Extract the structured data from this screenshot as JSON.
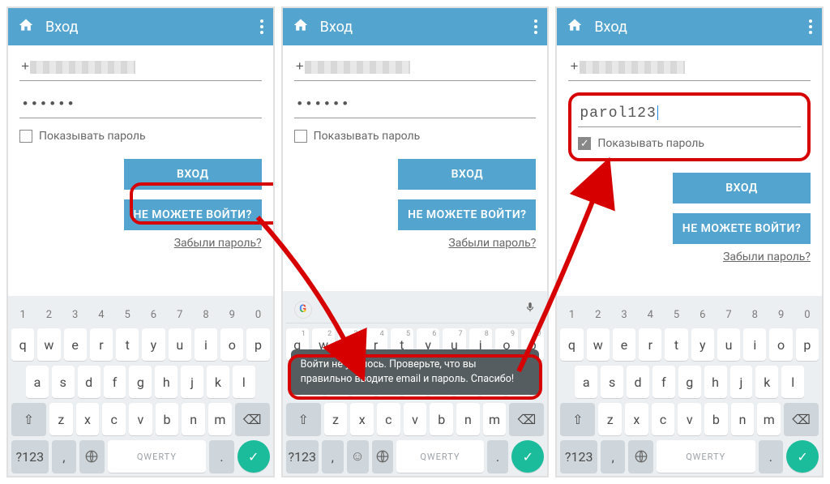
{
  "appBar": {
    "title": "Вход"
  },
  "fields": {
    "phonePrefix": "+",
    "passwordMasked": "••••••",
    "passwordVisible": "parol123"
  },
  "checkbox": {
    "label": "Показывать пароль"
  },
  "buttons": {
    "login": "ВХОД",
    "cantLogin": "НЕ МОЖЕТЕ ВОЙТИ?"
  },
  "forgot": "Забыли пароль?",
  "toast": "Войти не удалось. Проверьте, что вы правильно вводите email и пароль. Спасибо!",
  "keyboard": {
    "nums": [
      "1",
      "2",
      "3",
      "4",
      "5",
      "6",
      "7",
      "8",
      "9",
      "0"
    ],
    "row1": [
      "q",
      "w",
      "e",
      "r",
      "t",
      "y",
      "u",
      "i",
      "o",
      "p"
    ],
    "row2": [
      "a",
      "s",
      "d",
      "f",
      "g",
      "h",
      "j",
      "k",
      "l"
    ],
    "row3": [
      "z",
      "x",
      "c",
      "v",
      "b",
      "n",
      "m"
    ],
    "symKey": "?123",
    "spaceLabel": "QWERTY",
    "comma": ",",
    "period": ".",
    "shift": "⇧",
    "backspace": "⌫",
    "enter": "✓"
  }
}
